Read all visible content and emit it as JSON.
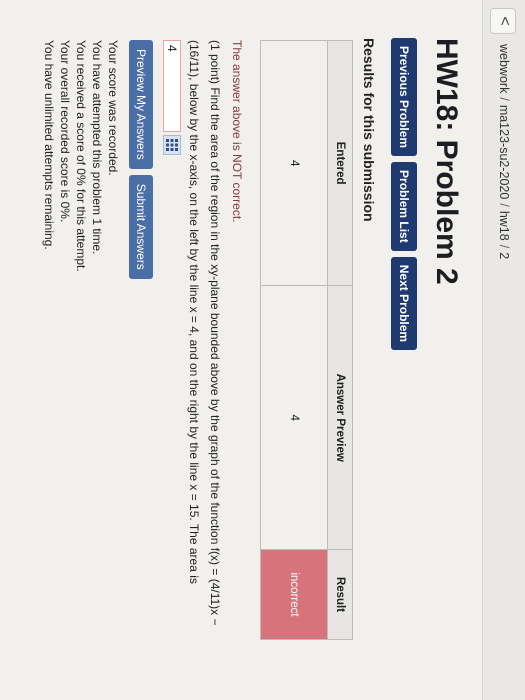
{
  "breadcrumb": [
    "webwork",
    "ma123-su2-2020",
    "hw18",
    "2"
  ],
  "back_glyph": "<",
  "page_title": "HW18: Problem 2",
  "nav_buttons": {
    "previous": "Previous Problem",
    "list": "Problem List",
    "next": "Next Problem"
  },
  "results": {
    "heading": "Results for this submission",
    "columns": [
      "Entered",
      "Answer Preview",
      "Result"
    ],
    "row": {
      "entered": "4",
      "preview": "4",
      "result": "incorrect"
    }
  },
  "status_message": "The answer above is NOT correct.",
  "problem": {
    "points": "(1 point)",
    "text_before_input": "Find the area of the region in the xy-plane bounded above by the graph of the function f(x) = (4/11)x − (16/11), below by the x-axis, on the left by the line x = 4, and on the right by the line x = 15. The area is",
    "answer_value": "4"
  },
  "actions": {
    "preview": "Preview My Answers",
    "submit": "Submit Answers"
  },
  "score_lines": [
    "Your score was recorded.",
    "You have attempted this problem 1 time.",
    "You received a score of 0% for this attempt.",
    "Your overall recorded score is 0%.",
    "You have unlimited attempts remaining."
  ],
  "colors": {
    "nav_button": "#1f3a70",
    "action_button": "#4a6fa6",
    "incorrect_cell": "#d6737b",
    "input_border_error": "#e8a3a6"
  }
}
